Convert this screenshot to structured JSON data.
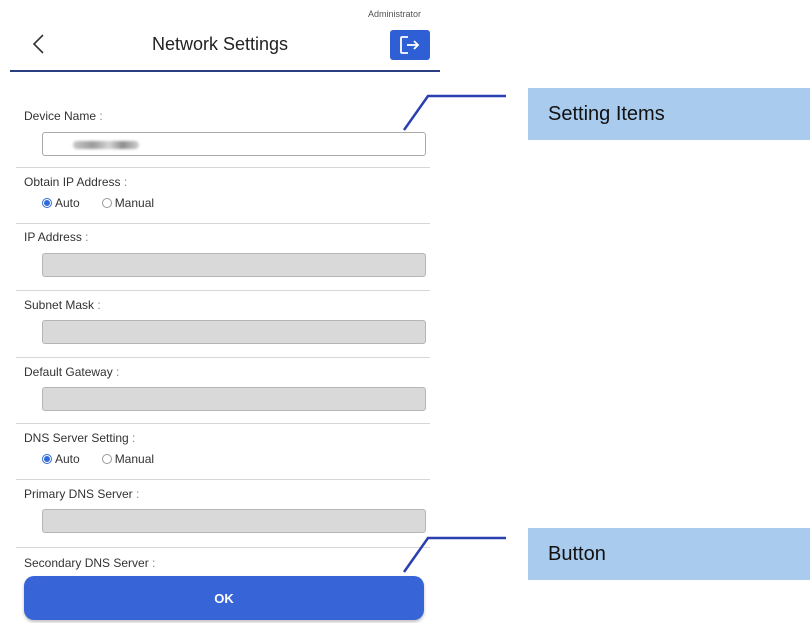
{
  "header": {
    "role": "Administrator",
    "title": "Network Settings"
  },
  "form": {
    "device_name": {
      "label": "Device Name",
      "colon": " :"
    },
    "obtain_ip": {
      "label": "Obtain IP Address",
      "colon": " :",
      "options": [
        "Auto",
        "Manual"
      ],
      "selected": "Auto"
    },
    "ip_address": {
      "label": "IP Address",
      "colon": " :"
    },
    "subnet_mask": {
      "label": "Subnet Mask",
      "colon": " :"
    },
    "default_gateway": {
      "label": "Default Gateway",
      "colon": " :"
    },
    "dns_setting": {
      "label": "DNS Server Setting",
      "colon": " :",
      "options": [
        "Auto",
        "Manual"
      ],
      "selected": "Auto"
    },
    "primary_dns": {
      "label": "Primary DNS Server",
      "colon": " :"
    },
    "secondary_dns": {
      "label": "Secondary DNS Server",
      "colon": " :"
    }
  },
  "buttons": {
    "ok": "OK"
  },
  "callouts": {
    "setting_items": "Setting Items",
    "button": "Button"
  },
  "colors": {
    "accent": "#3764d6",
    "header_line": "#2b3f80",
    "callout_bg": "#a9cbee"
  }
}
